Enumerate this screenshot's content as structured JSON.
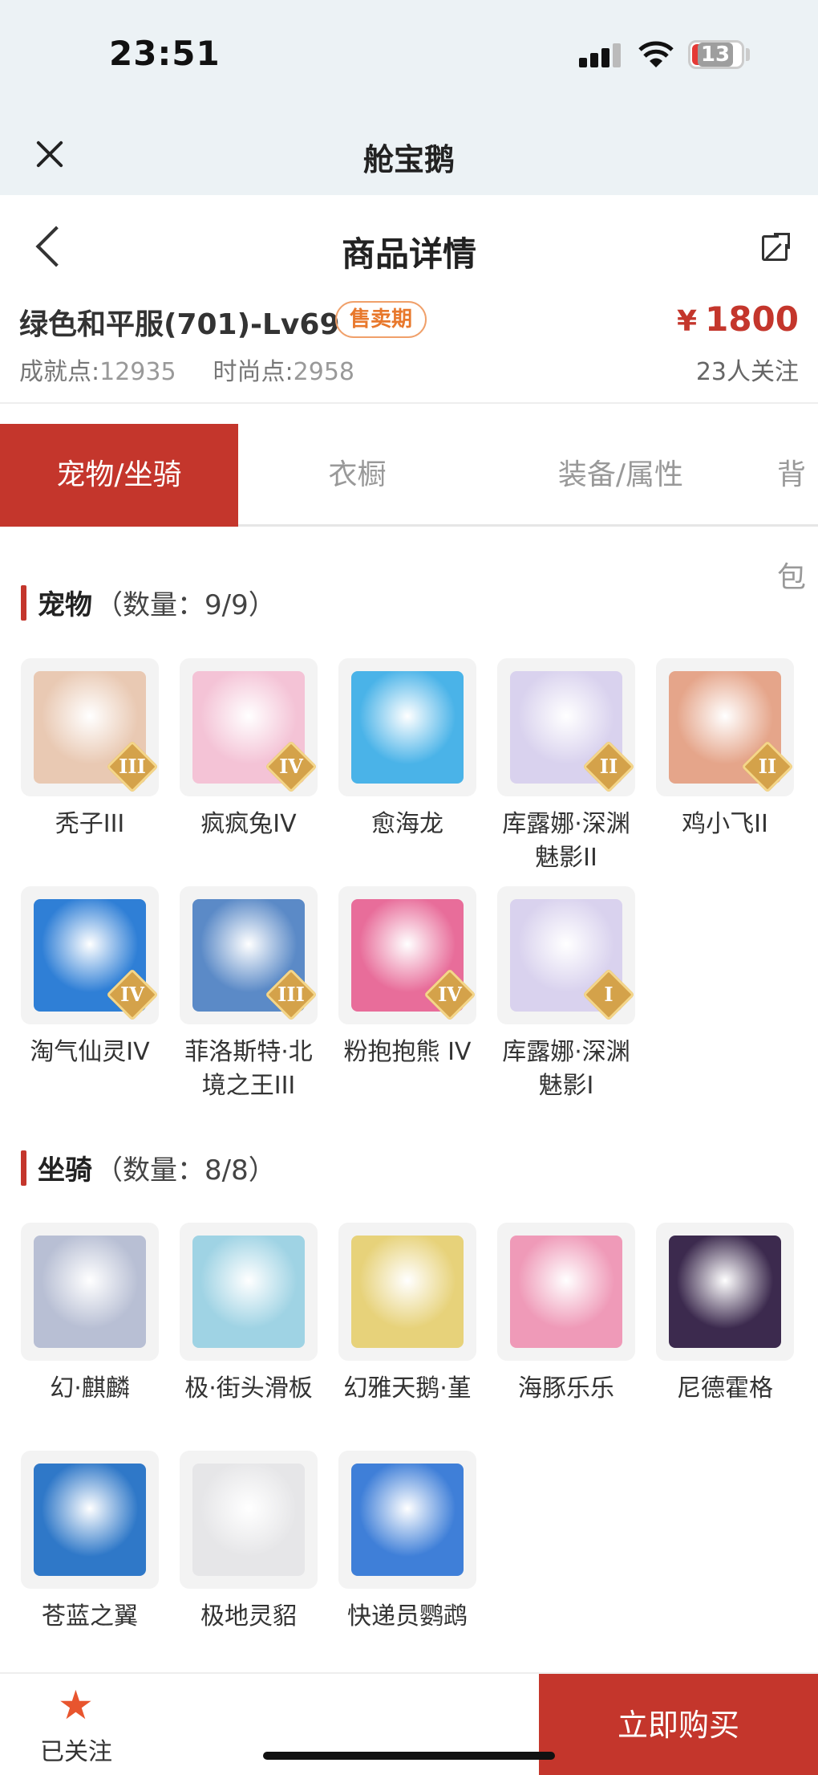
{
  "status": {
    "time": "23:51",
    "battery": "13"
  },
  "webview": {
    "title": "舱宝鹅"
  },
  "header": {
    "title": "商品详情"
  },
  "product": {
    "name": "绿色和平服(701)-Lv69",
    "badge": "售卖期",
    "price_symbol": "¥",
    "price": "1800",
    "achievement_label": "成就点:",
    "achievement_value": "12935",
    "fashion_label": "时尚点:",
    "fashion_value": "2958",
    "followers": "23人关注"
  },
  "tabs": [
    {
      "label": "宠物/坐骑"
    },
    {
      "label": "衣橱"
    },
    {
      "label": "装备/属性"
    },
    {
      "label": "背包"
    }
  ],
  "pets": {
    "title": "宠物",
    "count": "（数量：9/9）",
    "items": [
      {
        "name": "秃子III",
        "tier": "III",
        "color": "#e9c9b3"
      },
      {
        "name": "疯疯兔IV",
        "tier": "IV",
        "color": "#f4c3d6"
      },
      {
        "name": "愈海龙",
        "tier": "",
        "color": "#4ab3e8"
      },
      {
        "name": "库露娜·深渊魅影II",
        "tier": "II",
        "color": "#d9d2ee"
      },
      {
        "name": "鸡小飞II",
        "tier": "II",
        "color": "#e5a58a"
      },
      {
        "name": "淘气仙灵IV",
        "tier": "IV",
        "color": "#2f7fd6"
      },
      {
        "name": "菲洛斯特·北境之王III",
        "tier": "III",
        "color": "#5b8ac7"
      },
      {
        "name": "粉抱抱熊 IV",
        "tier": "IV",
        "color": "#e86d9a"
      },
      {
        "name": "库露娜·深渊魅影I",
        "tier": "I",
        "color": "#d9d2ee"
      }
    ]
  },
  "mounts": {
    "title": "坐骑",
    "count": "（数量：8/8）",
    "items": [
      {
        "name": "幻·麒麟",
        "color": "#b8bfd4"
      },
      {
        "name": "极·街头滑板",
        "color": "#9fd3e4"
      },
      {
        "name": "幻雅天鹅·堇",
        "color": "#e7d27a"
      },
      {
        "name": "海豚乐乐",
        "color": "#ef9ab8"
      },
      {
        "name": "尼德霍格",
        "color": "#3c2a4e"
      },
      {
        "name": "苍蓝之翼",
        "color": "#2f78c8"
      },
      {
        "name": "极地灵貂",
        "color": "#e6e6e8"
      },
      {
        "name": "快递员鹦鹉",
        "color": "#3f7fd8"
      }
    ]
  },
  "bottom": {
    "follow_label": "已关注",
    "buy_label": "立即购买"
  },
  "colors": {
    "accent": "#c4362c",
    "badge": "#e8782c"
  }
}
